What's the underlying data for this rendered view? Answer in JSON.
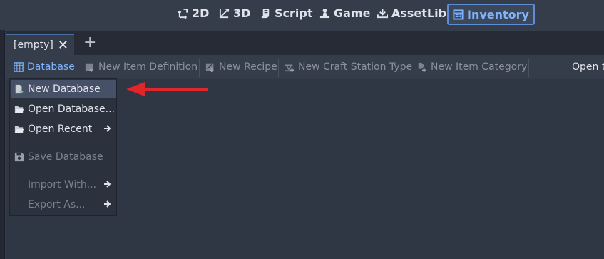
{
  "topbar": {
    "workspaces": [
      {
        "label": "2D",
        "icon": "2d-transform-icon"
      },
      {
        "label": "3D",
        "icon": "3d-transform-icon"
      },
      {
        "label": "Script",
        "icon": "script-icon"
      },
      {
        "label": "Game",
        "icon": "game-icon"
      },
      {
        "label": "AssetLib",
        "icon": "assetlib-icon"
      },
      {
        "label": "Inventory",
        "icon": "inventory-icon",
        "active": true
      }
    ]
  },
  "tabs": [
    {
      "label": "[empty]"
    }
  ],
  "toolbar": {
    "items": [
      {
        "label": "Database",
        "icon": "database-grid-icon",
        "active": true
      },
      {
        "label": "New Item Definition",
        "icon": "new-item-definition-icon",
        "disabled": true
      },
      {
        "label": "New Recipe",
        "icon": "new-recipe-icon",
        "disabled": true
      },
      {
        "label": "New Craft Station Type",
        "icon": "craft-station-icon",
        "disabled": true
      },
      {
        "label": "New Item Category",
        "icon": "item-category-icon",
        "disabled": true
      }
    ],
    "open_label": "Open t"
  },
  "database_menu": {
    "items": [
      {
        "label": "New Database",
        "icon": "new-file-icon",
        "hovered": true
      },
      {
        "label": "Open Database...",
        "icon": "folder-open-icon"
      },
      {
        "label": "Open Recent",
        "icon": "folder-open-icon",
        "submenu": true
      },
      {
        "label": "Save Database",
        "icon": "save-icon",
        "disabled": true
      },
      {
        "label": "Import With...",
        "icon": "",
        "submenu": true,
        "disabled": true
      },
      {
        "label": "Export As...",
        "icon": "",
        "submenu": true,
        "disabled": true
      }
    ]
  },
  "colors": {
    "background": "#363d4a",
    "accent": "#7fb2ff",
    "annotation_arrow": "#e0252b"
  }
}
